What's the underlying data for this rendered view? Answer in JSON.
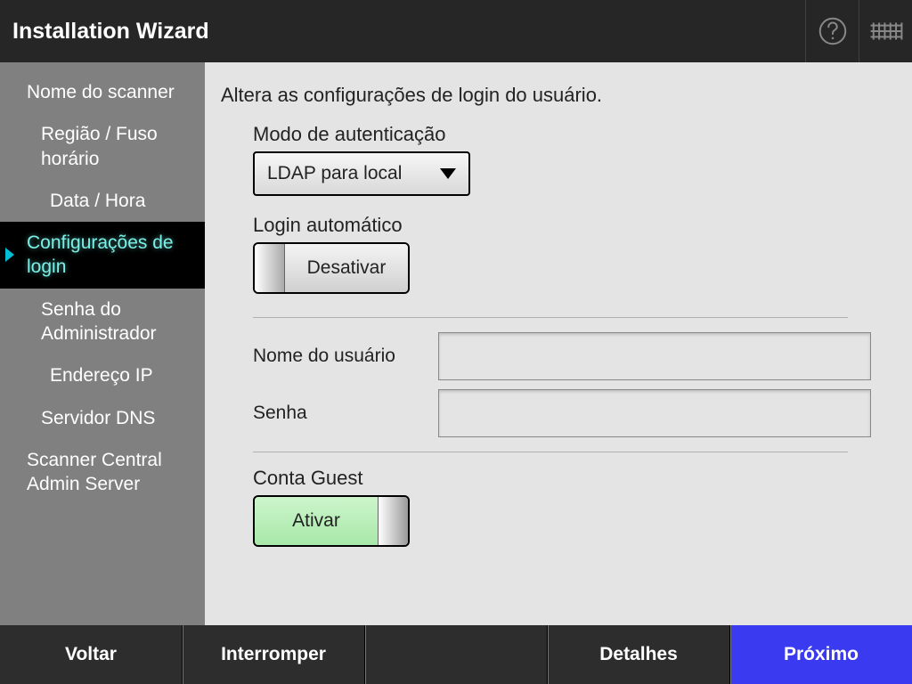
{
  "header": {
    "title": "Installation Wizard"
  },
  "sidebar": {
    "items": [
      {
        "label": "Nome do scanner",
        "level": 1,
        "active": false
      },
      {
        "label": "Região / Fuso horário",
        "level": 2,
        "active": false
      },
      {
        "label": "Data / Hora",
        "level": 3,
        "active": false
      },
      {
        "label": "Configurações de login",
        "level": 1,
        "active": true
      },
      {
        "label": "Senha do Administrador",
        "level": 2,
        "active": false
      },
      {
        "label": "Endereço IP",
        "level": 3,
        "active": false
      },
      {
        "label": "Servidor DNS",
        "level": 2,
        "active": false
      },
      {
        "label": "Scanner Central Admin Server",
        "level": 1,
        "active": false
      }
    ]
  },
  "main": {
    "description": "Altera as configurações de login do usuário.",
    "auth_mode_label": "Modo de autenticação",
    "auth_mode_value": "LDAP para local",
    "auto_login_label": "Login automático",
    "auto_login_state": "Desativar",
    "username_label": "Nome do usuário",
    "username_value": "",
    "password_label": "Senha",
    "password_value": "",
    "guest_label": "Conta Guest",
    "guest_state": "Ativar"
  },
  "bottom": {
    "back": "Voltar",
    "interrupt": "Interromper",
    "details": "Detalhes",
    "next": "Próximo"
  }
}
